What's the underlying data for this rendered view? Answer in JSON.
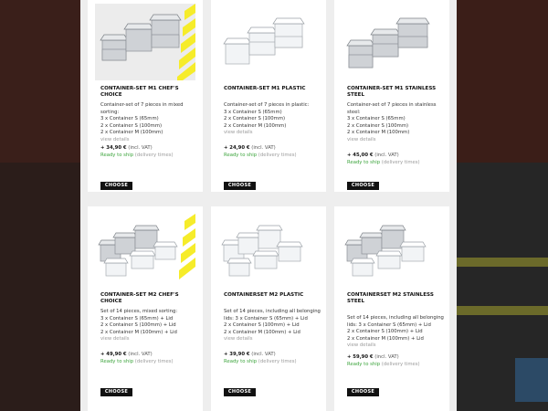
{
  "products": [
    {
      "title": "CONTAINER-SET M1 CHEF'S CHOICE",
      "desc_lines": [
        "Container-set of 7 pieces in mixed sorting:",
        "3 x Container S (65mm)",
        "2 x Container S (100mm)",
        "2 x Container M (100mm)"
      ],
      "link": "view details",
      "price": "+ 34,90 €",
      "vat": "(incl. VAT)",
      "ready": "Ready to ship",
      "delivery": "(delivery times)",
      "button": "CHOOSE",
      "image": "steel-pans-striped"
    },
    {
      "title": "CONTAINER-SET M1 PLASTIC",
      "desc_lines": [
        "Container-set of 7 pieces in plastic:",
        "3 x Container S (65mm)",
        "2 x Container S (100mm)",
        "2 x Container M (100mm)"
      ],
      "link": "view details",
      "price": "+ 24,90 €",
      "vat": "(incl. VAT)",
      "ready": "Ready to ship",
      "delivery": "(delivery times)",
      "button": "CHOOSE",
      "image": "clear-pans"
    },
    {
      "title": "CONTAINER-SET M1 STAINLESS STEEL",
      "desc_lines": [
        "Container-set of 7 pieces in stainless",
        "steel:",
        "3 x Container S (65mm)",
        "2 x Container S (100mm)",
        "2 x Container M (100mm)"
      ],
      "link": "view details",
      "price": "+ 45,00 €",
      "vat": "(incl. VAT)",
      "ready": "Ready to ship",
      "delivery": "(delivery times)",
      "button": "CHOOSE",
      "image": "steel-pans"
    },
    {
      "title": "CONTAINER-SET M2 CHEF'S CHOICE",
      "desc_lines": [
        "Set of 14 pieces, mixed sorting:",
        "3 x Container S (65mm) + Lid",
        "2 x Container S (100mm) + Lid",
        "2 x Container M (100mm) + Lid"
      ],
      "link": "view details",
      "price": "+ 49,90 €",
      "vat": "(incl. VAT)",
      "ready": "Ready to ship",
      "delivery": "(delivery times)",
      "button": "CHOOSE",
      "image": "mixed-pans-striped"
    },
    {
      "title": "CONTAINERSET M2 PLASTIC",
      "desc_lines": [
        "Set of 14 pieces, including all belonging",
        "lids: 3 x Container S (65mm) + Lid",
        "2 x Container S (100mm) + Lid",
        "2 x Container M (100mm) + Lid"
      ],
      "link": "view details",
      "price": "+ 39,90 €",
      "vat": "(incl. VAT)",
      "ready": "Ready to ship",
      "delivery": "(delivery times)",
      "button": "CHOOSE",
      "image": "clear-pans-lids"
    },
    {
      "title": "CONTAINERSET M2 STAINLESS STEEL",
      "desc_lines": [
        "Set of 14 pieces, including all belonging",
        "lids: 3 x Container S (65mm) + Lid",
        "2 x Container S (100mm) + Lid",
        "2 x Container M (100mm) + Lid"
      ],
      "link": "view details",
      "price": "+ 59,90 €",
      "vat": "(incl. VAT)",
      "ready": "Ready to ship",
      "delivery": "(delivery times)",
      "button": "CHOOSE",
      "image": "steel-pans-lids"
    }
  ],
  "colors": {
    "accent_yellow": "#f6ec2a",
    "ready_green": "#3aa33a",
    "button_black": "#111111"
  }
}
